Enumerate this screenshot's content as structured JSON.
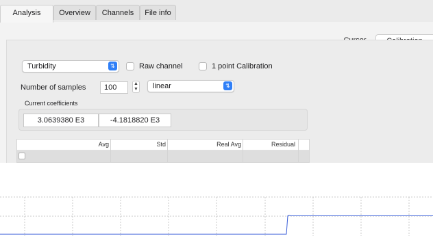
{
  "tabs": [
    {
      "label": "Analysis",
      "active": true
    },
    {
      "label": "Overview",
      "active": false
    },
    {
      "label": "Channels",
      "active": false
    },
    {
      "label": "File info",
      "active": false
    }
  ],
  "segmented": {
    "cursor_label": "Cursor",
    "calibration_label": "Calibration",
    "selected": "Calibration"
  },
  "controls": {
    "channel_select": "Turbidity",
    "raw_channel_label": "Raw channel",
    "raw_channel_checked": false,
    "one_point_label": "1 point Calibration",
    "one_point_checked": false,
    "samples_label": "Number of samples",
    "samples_value": "100",
    "fit_select": "linear"
  },
  "coefficients": {
    "title": "Current coefficients",
    "values": [
      "3.0639380 E3",
      "-4.1818820 E3"
    ]
  },
  "table": {
    "columns": [
      "Avg",
      "Std",
      "Real Avg",
      "Residual"
    ],
    "rows": [
      {
        "checked": false,
        "avg": "",
        "std": "",
        "real_avg": "",
        "residual": ""
      }
    ]
  },
  "colors": {
    "accent": "#2f7ff7",
    "trace": "#3a5fd8"
  },
  "plot": {
    "trace_levels": {
      "before_step": 0.1,
      "after_step": 0.5
    }
  }
}
